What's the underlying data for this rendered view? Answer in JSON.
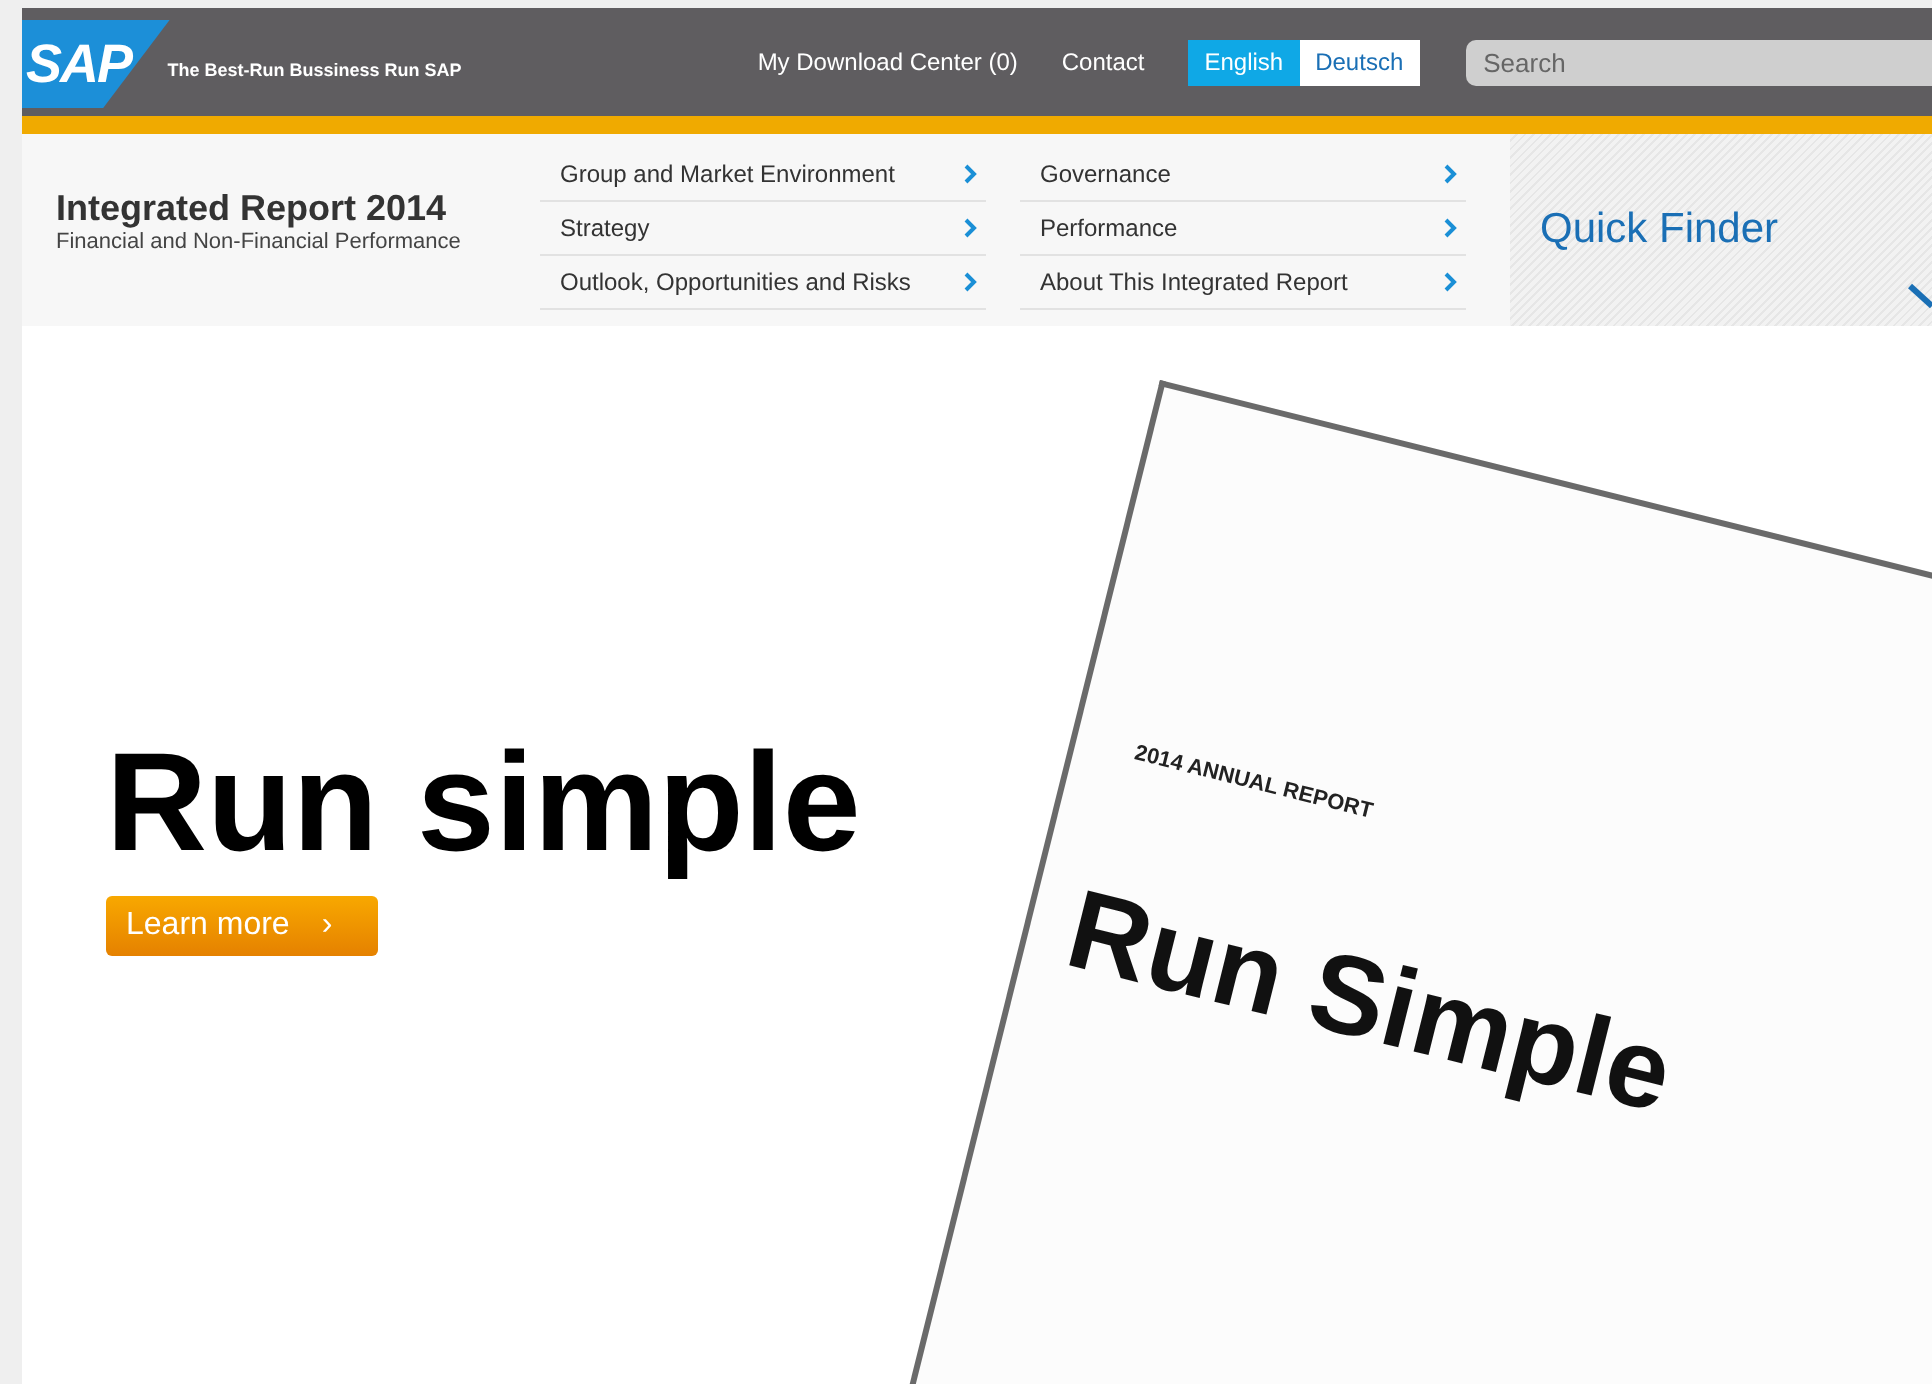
{
  "header": {
    "logo": "SAP",
    "tagline": "The Best-Run Bussiness Run SAP",
    "links": [
      "My Download Center (0)",
      "Contact"
    ],
    "languages": [
      {
        "label": "English",
        "selected": true
      },
      {
        "label": "Deutsch",
        "selected": false
      }
    ],
    "search": {
      "placeholder": "Search"
    }
  },
  "report": {
    "title": "Integrated Report 2014",
    "subtitle": "Financial and Non-Financial Performance"
  },
  "menu_columns": [
    [
      "Group and Market Environment",
      "Strategy",
      "Outlook, Opportunities and Risks"
    ],
    [
      "Governance",
      "Performance",
      "About This Integrated Report"
    ]
  ],
  "quick_finder": {
    "label": "Quick Finder"
  },
  "hero": {
    "title": "Run simple",
    "button": "Learn more",
    "button_icon": "›"
  },
  "cover": {
    "overline": "2014 ANNUAL REPORT",
    "title": "Run Simple"
  }
}
